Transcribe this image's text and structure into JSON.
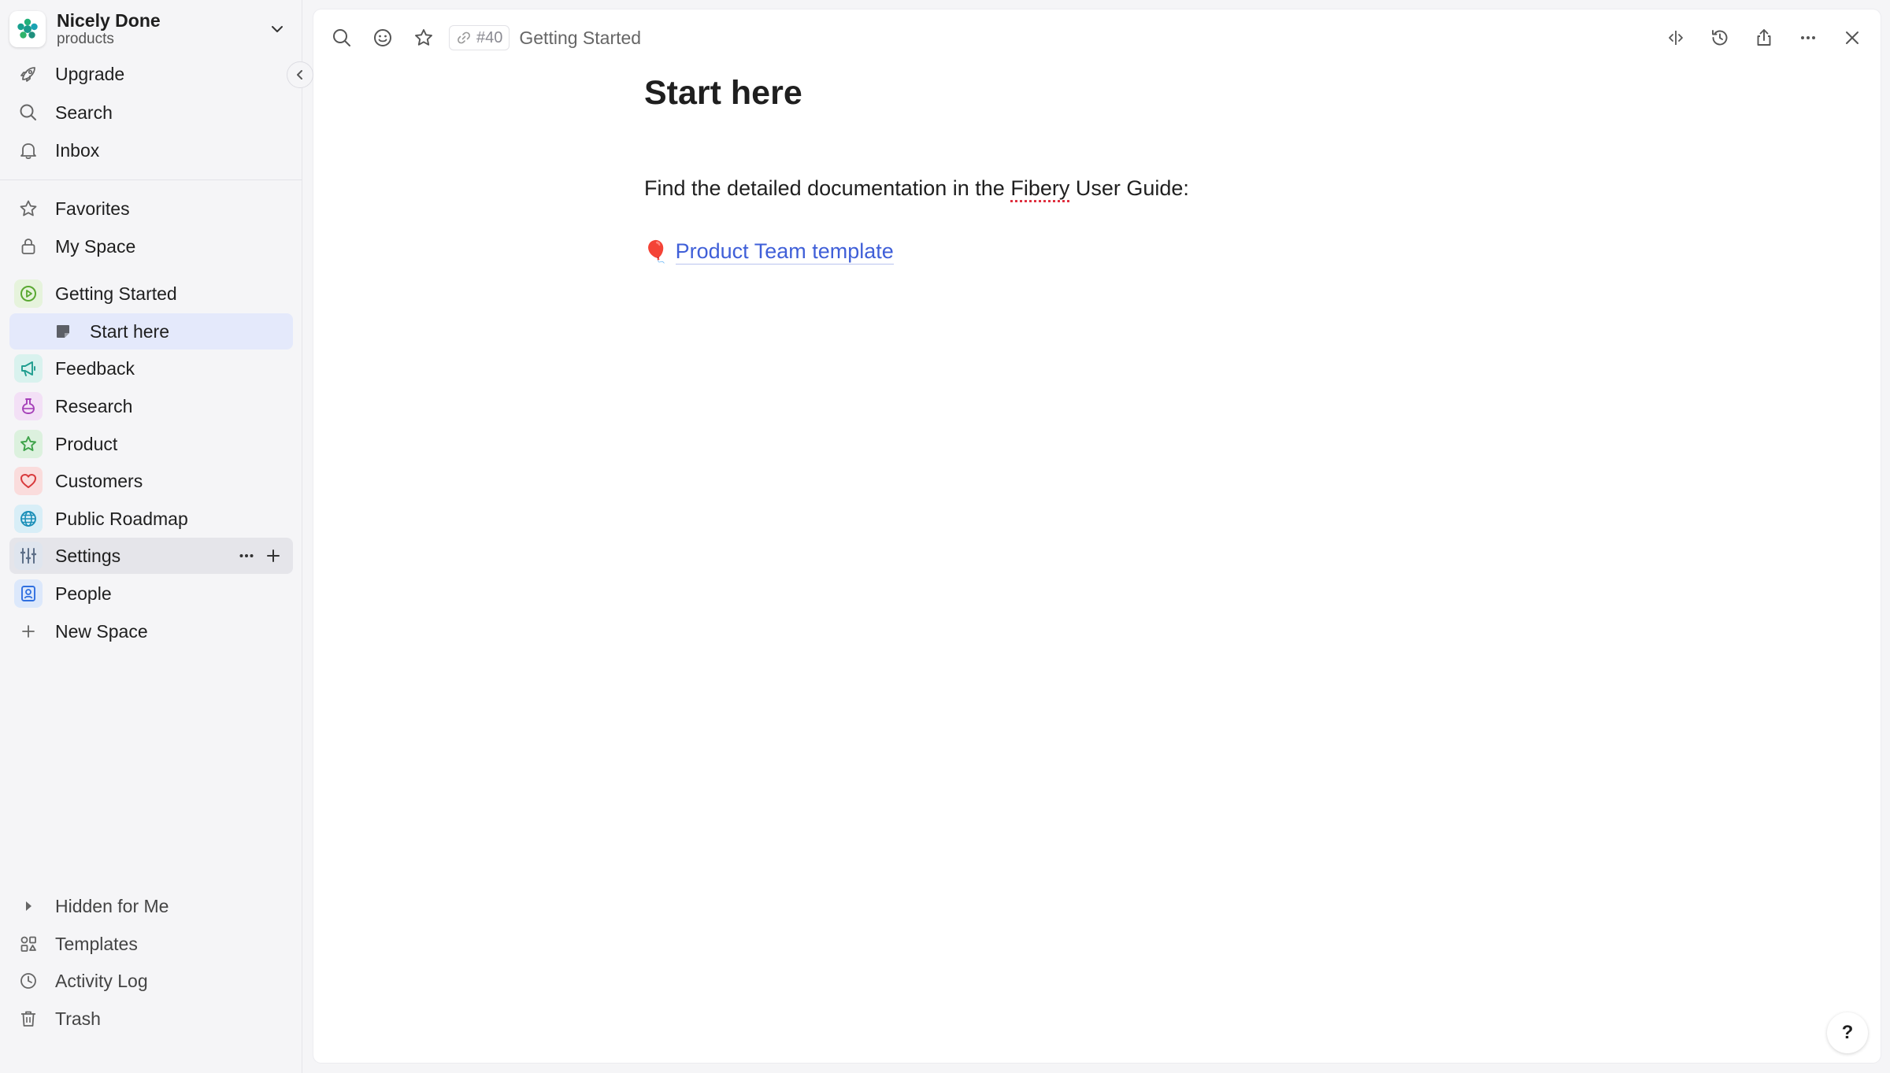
{
  "workspace": {
    "name": "Nicely Done",
    "subtitle": "products"
  },
  "top_nav": [
    {
      "label": "Upgrade",
      "icon": "rocket-icon"
    },
    {
      "label": "Search",
      "icon": "search-icon"
    },
    {
      "label": "Inbox",
      "icon": "bell-icon"
    }
  ],
  "personal_nav": [
    {
      "label": "Favorites",
      "icon": "star-icon"
    },
    {
      "label": "My Space",
      "icon": "lock-icon"
    }
  ],
  "spaces": [
    {
      "label": "Getting Started",
      "icon": "play-circle-icon",
      "color": "#5aa832",
      "bg": "#e6f3dc"
    },
    {
      "label": "Start here",
      "icon": "document-icon",
      "child": true,
      "active": true
    },
    {
      "label": "Feedback",
      "icon": "megaphone-icon",
      "color": "#1f9d8f",
      "bg": "#d9f2ee"
    },
    {
      "label": "Research",
      "icon": "flask-icon",
      "color": "#a53fb8",
      "bg": "#f3e0f6"
    },
    {
      "label": "Product",
      "icon": "star-icon",
      "color": "#3ea34a",
      "bg": "#dcf1de"
    },
    {
      "label": "Customers",
      "icon": "heart-icon",
      "color": "#d8393b",
      "bg": "#fadcdc"
    },
    {
      "label": "Public Roadmap",
      "icon": "globe-icon",
      "color": "#1a8fb8",
      "bg": "#d8eef7"
    },
    {
      "label": "Settings",
      "icon": "sliders-icon",
      "color": "#5d6f88",
      "bg": "#dfe5ee",
      "hovered": true
    },
    {
      "label": "People",
      "icon": "person-badge-icon",
      "color": "#2f6fe0",
      "bg": "#dce8fb"
    },
    {
      "label": "New Space",
      "icon": "plus-icon"
    }
  ],
  "bottom_nav": [
    {
      "label": "Hidden for Me",
      "icon": "triangle-right-icon"
    },
    {
      "label": "Templates",
      "icon": "templates-icon"
    },
    {
      "label": "Activity Log",
      "icon": "clock-icon"
    },
    {
      "label": "Trash",
      "icon": "trash-icon"
    }
  ],
  "toolbar": {
    "id_chip": "#40",
    "breadcrumb": "Getting Started"
  },
  "document": {
    "title": "Start here",
    "text_before": "Find the detailed documentation in the ",
    "text_spell": "Fibery",
    "text_after": " User Guide:",
    "link_emoji": "🎈",
    "link_label": "Product Team template"
  },
  "help": {
    "label": "?"
  },
  "colors": {
    "accent": "#3f5fd8",
    "active_bg": "#e4e9fb",
    "hover_bg": "#e5e5ea"
  }
}
